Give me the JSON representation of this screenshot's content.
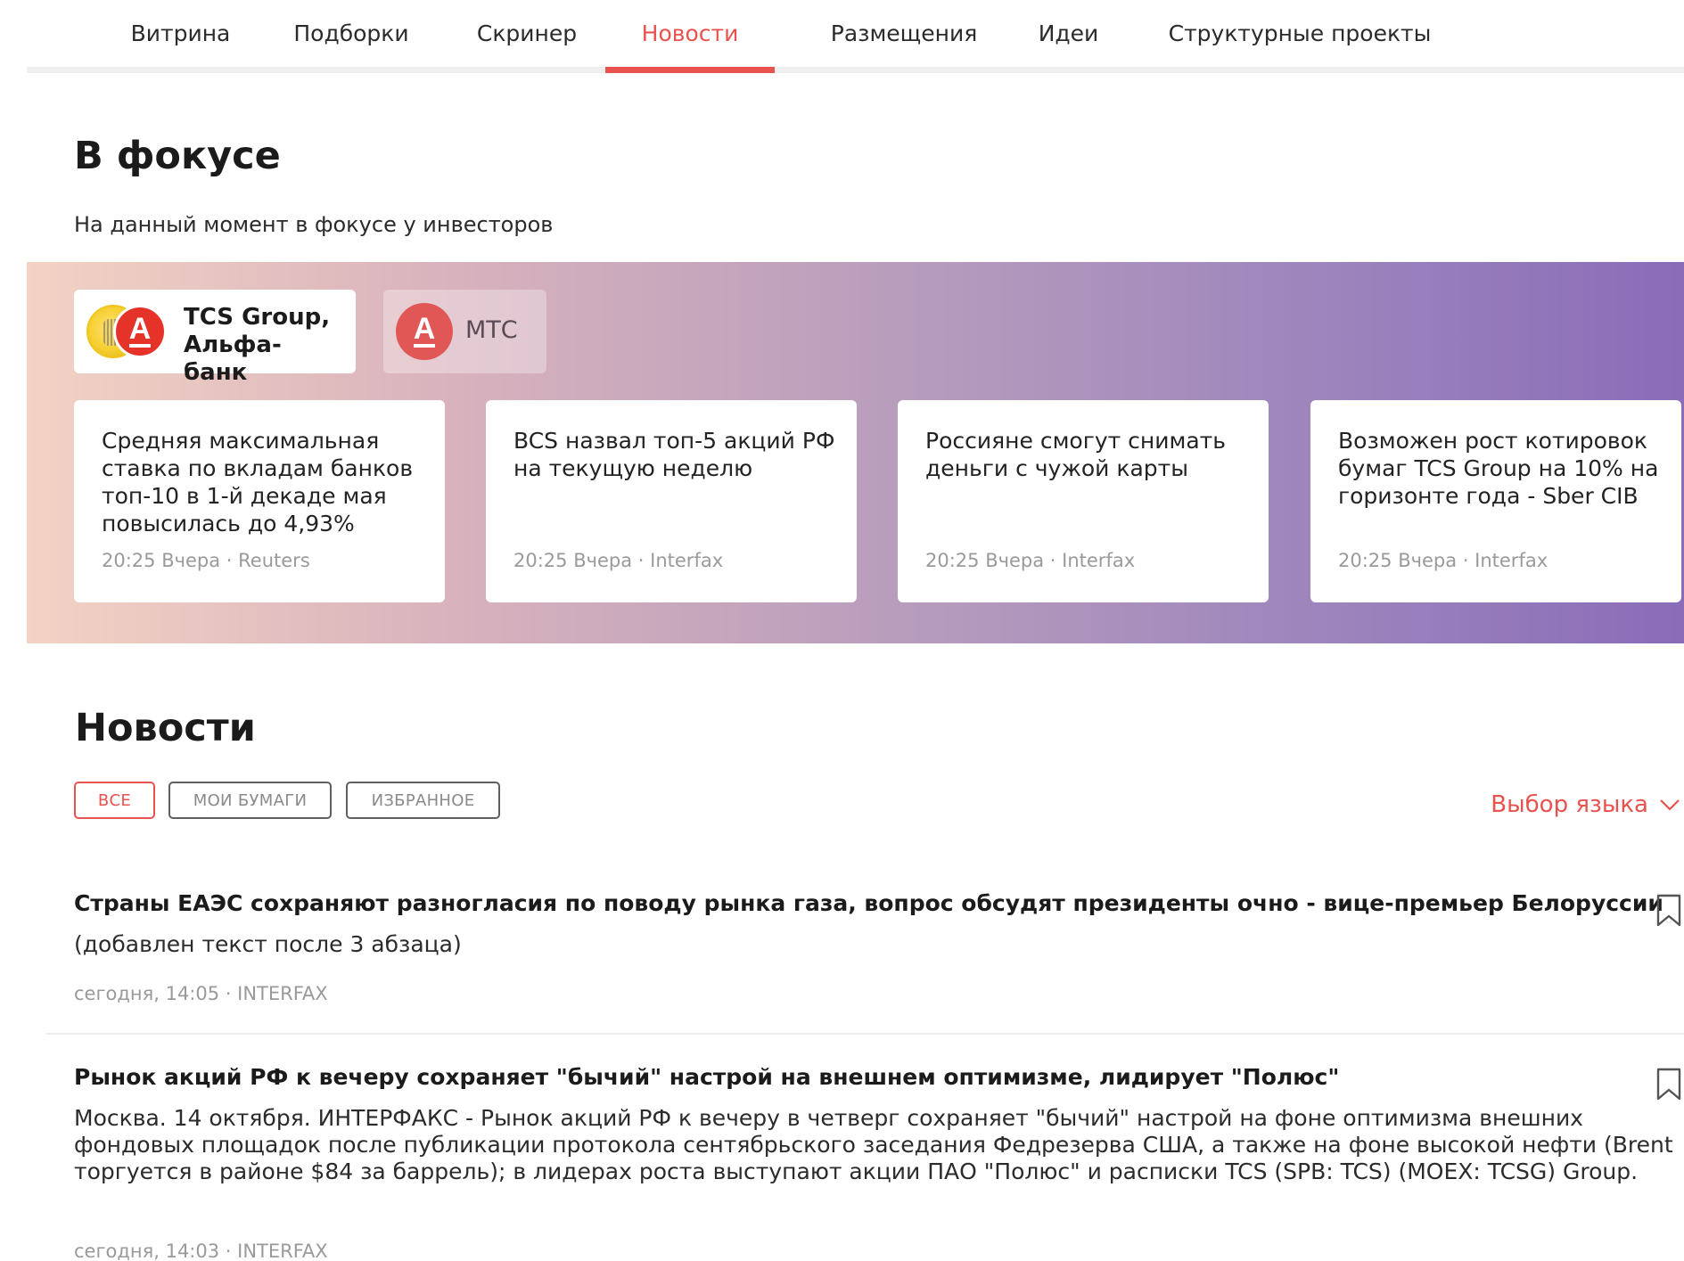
{
  "nav": {
    "tabs": [
      {
        "label": "Витрина"
      },
      {
        "label": "Подборки"
      },
      {
        "label": "Скринер"
      },
      {
        "label": "Новости"
      },
      {
        "label": "Размещения"
      },
      {
        "label": "Идеи"
      },
      {
        "label": "Структурные проекты"
      }
    ],
    "active": "Новости"
  },
  "focus": {
    "title": "В фокусе",
    "subtitle": "На данный момент в фокусе у инвесторов",
    "companies": [
      {
        "label": "TCS Group, Альфа-банк",
        "logo_text": "А",
        "icons": [
          "tcs-group-logo",
          "alfa-bank-logo"
        ]
      },
      {
        "label": "МТС",
        "logo_text": "А",
        "icons": [
          "alfa-bank-logo"
        ]
      }
    ],
    "cards": [
      {
        "title": "Средняя максимальная ставка по вкладам банков топ-10 в 1-й декаде мая повысилась до 4,93%",
        "meta": "20:25 Вчера · Reuters"
      },
      {
        "title": "BCS назвал топ-5 акций РФ на текущую неделю",
        "meta": "20:25 Вчера · Interfax"
      },
      {
        "title": "Россияне смогут снимать деньги с чужой карты",
        "meta": "20:25 Вчера · Interfax"
      },
      {
        "title": "Возможен рост котировок бумаг TCS Group на 10% на горизонте года - Sber CIB",
        "meta": "20:25 Вчера · Interfax"
      }
    ]
  },
  "news": {
    "title": "Новости",
    "filters": [
      {
        "label": "ВСЕ",
        "active": true
      },
      {
        "label": "МОИ БУМАГИ",
        "active": false
      },
      {
        "label": "ИЗБРАННОЕ",
        "active": false
      }
    ],
    "language_select": "Выбор языка",
    "items": [
      {
        "title": "Страны ЕАЭС сохраняют разногласия по поводу рынка газа, вопрос обсудят президенты очно - вице-премьер Белоруссии",
        "text": "(добавлен текст после 3 абзаца)",
        "meta": "сегодня, 14:05 · INTERFAX"
      },
      {
        "title": "Рынок акций РФ к вечеру сохраняет \"бычий\" настрой на внешнем оптимизме, лидирует \"Полюс\"",
        "text": "Москва. 14 октября. ИНТЕРФАКС - Рынок акций РФ к вечеру в четверг сохраняет \"бычий\" настрой на фоне оптимизма внешних фондовых площадок после публикации протокола сентябрьского заседания Федрезерва США, а также на фоне высокой нефти (Brent торгуется в районе $84 за баррель); в лидерах роста выступают акции ПАО \"Полюс\" и расписки TCS (SPB: TCS) (MOEX: TCSG) Group.",
        "meta": "сегодня, 14:03 · INTERFAX"
      }
    ]
  },
  "colors": {
    "accent": "#e8524f",
    "alfa_red": "#e5332a",
    "gradient_start": "#f2d3c4",
    "gradient_end": "#8a6cb8",
    "meta_gray": "#9a9a9a"
  }
}
